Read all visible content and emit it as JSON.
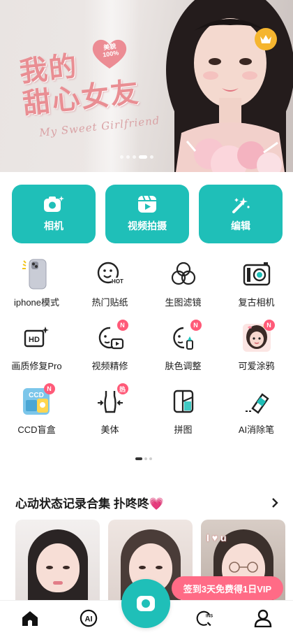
{
  "banner": {
    "title_line1": "我的",
    "title_line2": "甜心女友",
    "subtitle": "My Sweet Girlfriend",
    "heart_badge_text": "美貌100%",
    "crown_icon": "crown-icon",
    "slide_count": 5,
    "active_slide": 4
  },
  "quick_actions": [
    {
      "label": "相机",
      "icon": "camera-icon"
    },
    {
      "label": "视频拍摄",
      "icon": "video-play-icon"
    },
    {
      "label": "编辑",
      "icon": "magic-wand-icon"
    }
  ],
  "tools": [
    {
      "label": "iphone模式",
      "icon": "iphone-icon",
      "badge": ""
    },
    {
      "label": "热门贴纸",
      "icon": "hot-sticker-icon",
      "badge": ""
    },
    {
      "label": "生图滤镜",
      "icon": "filter-circles-icon",
      "badge": ""
    },
    {
      "label": "复古相机",
      "icon": "retro-camera-icon",
      "badge": ""
    },
    {
      "label": "画质修复Pro",
      "icon": "hd-enhance-icon",
      "badge": ""
    },
    {
      "label": "视频精修",
      "icon": "video-retouch-icon",
      "badge": "N"
    },
    {
      "label": "肤色调整",
      "icon": "skin-tone-icon",
      "badge": "N"
    },
    {
      "label": "可爱涂鸦",
      "icon": "cute-doodle-icon",
      "badge": "N"
    },
    {
      "label": "CCD盲盒",
      "icon": "ccd-blind-box-icon",
      "badge": "N"
    },
    {
      "label": "美体",
      "icon": "body-shape-icon",
      "badge": "热"
    },
    {
      "label": "拼图",
      "icon": "collage-icon",
      "badge": ""
    },
    {
      "label": "AI消除笔",
      "icon": "ai-eraser-icon",
      "badge": ""
    }
  ],
  "pager": {
    "pages": 3,
    "active": 1
  },
  "section": {
    "title": "心动状态记录合集 扑咚咚💗",
    "more_icon": "chevron-right-icon",
    "cards": [
      {
        "kind": "portrait"
      },
      {
        "kind": "portrait"
      },
      {
        "kind": "portrait",
        "overlay_text": "I ♥ u"
      }
    ]
  },
  "vip_tip": "签到3天免费得1日VIP",
  "bottom_nav": [
    {
      "icon": "home-icon"
    },
    {
      "icon": "ai-icon",
      "label": "AI"
    },
    {
      "icon": "camera-icon"
    },
    {
      "icon": "ins-search-icon",
      "label": "INS"
    },
    {
      "icon": "profile-icon"
    }
  ],
  "colors": {
    "accent": "#1fbfb8",
    "badge": "#ff5a78",
    "vip": "#ff6b86",
    "crown": "#f5b52f"
  }
}
